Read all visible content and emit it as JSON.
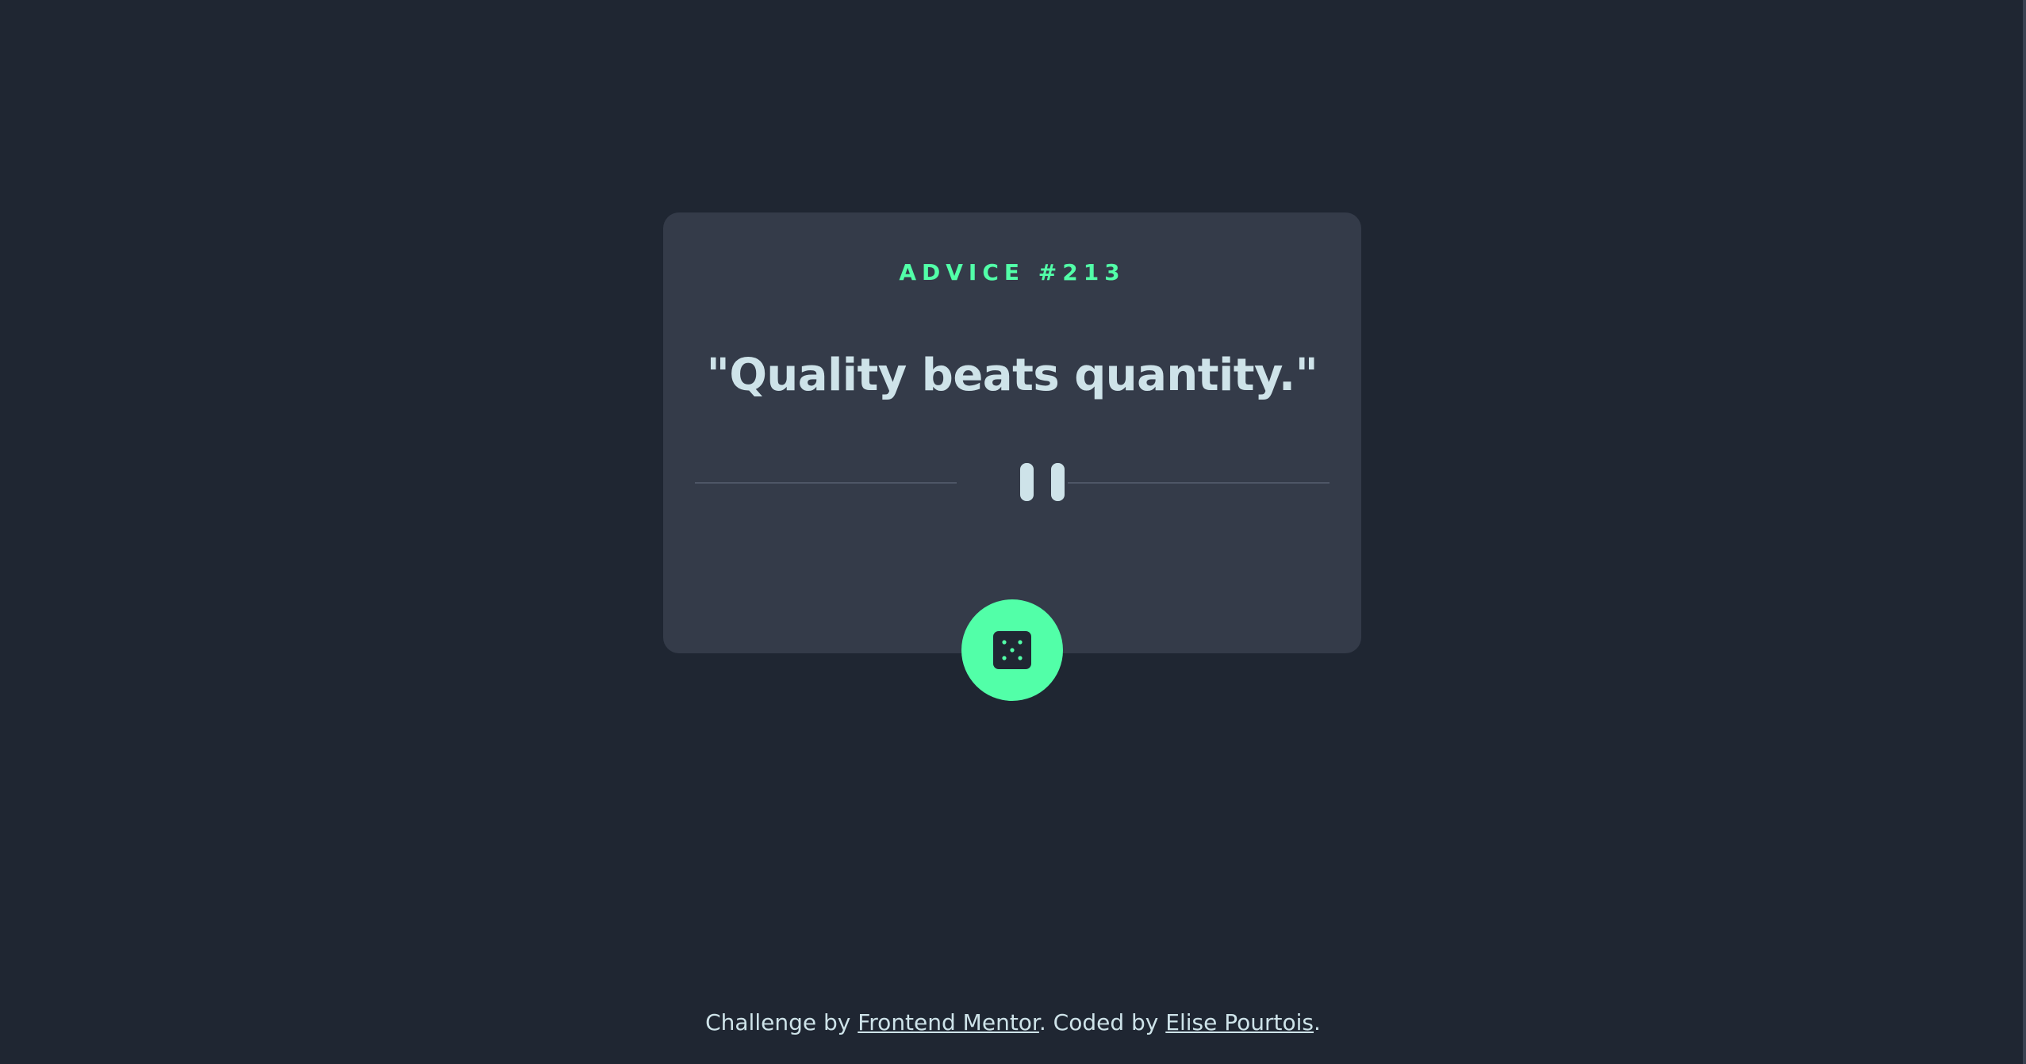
{
  "advice": {
    "label": "ADVICE #213",
    "quote": "\"Quality beats quantity.\""
  },
  "icons": {
    "divider": "pause-icon",
    "button": "dice-icon"
  },
  "footer": {
    "prefix": "Challenge by ",
    "link1": "Frontend Mentor",
    "middle": ". Coded by ",
    "link2": "Elise Pourtois",
    "suffix": "."
  },
  "colors": {
    "background": "#1f2632",
    "card": "#343b49",
    "accent": "#52ffa8",
    "text": "#cee3e9"
  }
}
